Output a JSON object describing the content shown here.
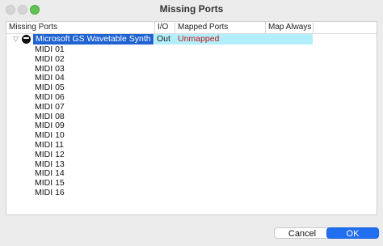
{
  "window": {
    "title": "Missing Ports"
  },
  "columns": [
    "Missing Ports",
    "I/O",
    "Mapped Ports",
    "Map Always"
  ],
  "device": {
    "name": "Microsoft GS Wavetable Synth",
    "io": "Out",
    "mapped": "Unmapped",
    "icon": "midi-device-icon"
  },
  "ports": [
    "MIDI 01",
    "MIDI 02",
    "MIDI 03",
    "MIDI 04",
    "MIDI 05",
    "MIDI 06",
    "MIDI 07",
    "MIDI 08",
    "MIDI 09",
    "MIDI 10",
    "MIDI 11",
    "MIDI 12",
    "MIDI 13",
    "MIDI 14",
    "MIDI 15",
    "MIDI 16"
  ],
  "buttons": {
    "cancel": "Cancel",
    "ok": "OK"
  },
  "colors": {
    "accent": "#1f63d2",
    "row_highlight": "#b3eefb",
    "unmapped": "#c01818"
  }
}
